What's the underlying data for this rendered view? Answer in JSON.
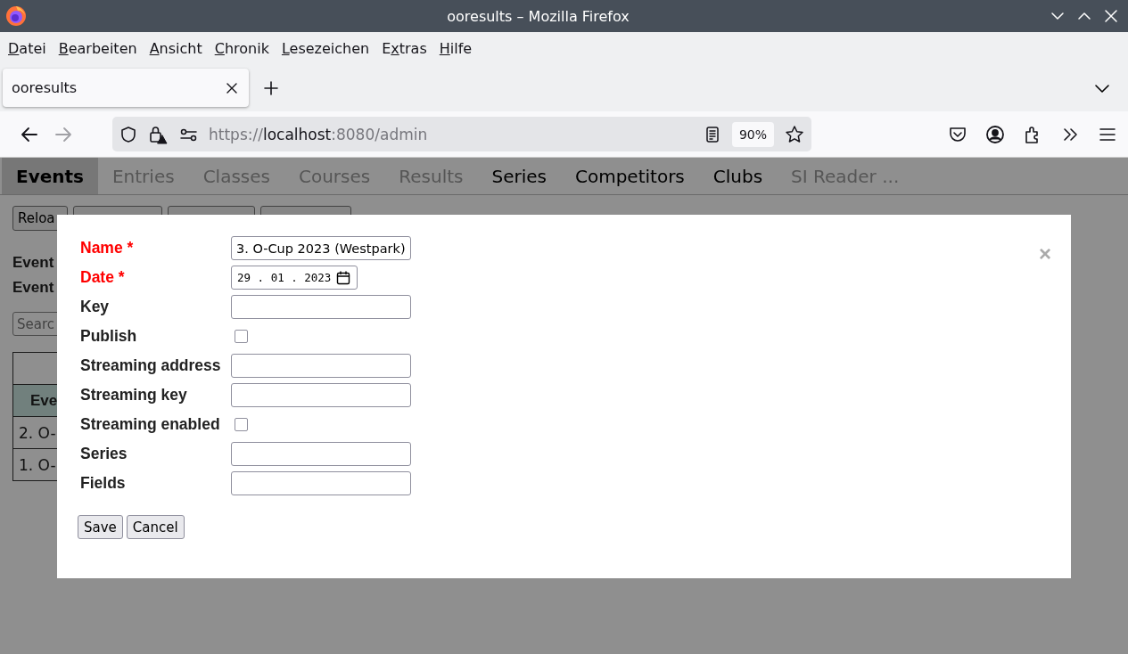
{
  "window": {
    "title": "ooresults – Mozilla Firefox"
  },
  "menu": [
    {
      "key": "D",
      "after": "atei"
    },
    {
      "key": "B",
      "after": "earbeiten"
    },
    {
      "key": "A",
      "after": "nsicht"
    },
    {
      "key": "C",
      "after": "hronik"
    },
    {
      "key": "L",
      "after": "esezeichen"
    },
    {
      "before": "E",
      "key": "x",
      "after": "tras"
    },
    {
      "key": "H",
      "after": "ilfe"
    }
  ],
  "browser_tabs": [
    {
      "title": "ooresults",
      "selected": true
    }
  ],
  "address_bar": {
    "scheme": "https://",
    "host": "localhost",
    "rest": ":8080/admin",
    "zoom": "90%"
  },
  "nav": [
    {
      "label": "Events",
      "selected": true,
      "disabled": false
    },
    {
      "label": "Entries",
      "selected": false,
      "disabled": true
    },
    {
      "label": "Classes",
      "selected": false,
      "disabled": true
    },
    {
      "label": "Courses",
      "selected": false,
      "disabled": true
    },
    {
      "label": "Results",
      "selected": false,
      "disabled": true
    },
    {
      "label": "Series",
      "selected": false,
      "disabled": false
    },
    {
      "label": "Competitors",
      "selected": false,
      "disabled": false
    },
    {
      "label": "Clubs",
      "selected": false,
      "disabled": false
    },
    {
      "label": "SI Reader ...",
      "selected": false,
      "disabled": true
    }
  ],
  "page": {
    "toolbar_button": "Reloa",
    "info_lines": [
      "Event",
      "Event"
    ],
    "search": {
      "placeholder": "Searc"
    },
    "table": {
      "header": "Eve",
      "rows": [
        "2. O-",
        "1. O-"
      ]
    }
  },
  "dialog": {
    "fields": [
      {
        "kind": "text",
        "label": "Name *",
        "required": true,
        "value": "3. O-Cup 2023 (Westpark)"
      },
      {
        "kind": "date",
        "label": "Date *",
        "required": true,
        "value": "29 . 01 . 2023"
      },
      {
        "kind": "text",
        "label": "Key",
        "required": false
      },
      {
        "kind": "checkbox",
        "label": "Publish",
        "required": false,
        "checked": false
      },
      {
        "kind": "text",
        "label": "Streaming address",
        "required": false
      },
      {
        "kind": "text",
        "label": "Streaming key",
        "required": false
      },
      {
        "kind": "checkbox",
        "label": "Streaming enabled",
        "required": false,
        "checked": false
      },
      {
        "kind": "text",
        "label": "Series",
        "required": false
      },
      {
        "kind": "text",
        "label": "Fields",
        "required": false
      }
    ],
    "buttons": [
      "Save",
      "Cancel"
    ],
    "close": "×"
  }
}
